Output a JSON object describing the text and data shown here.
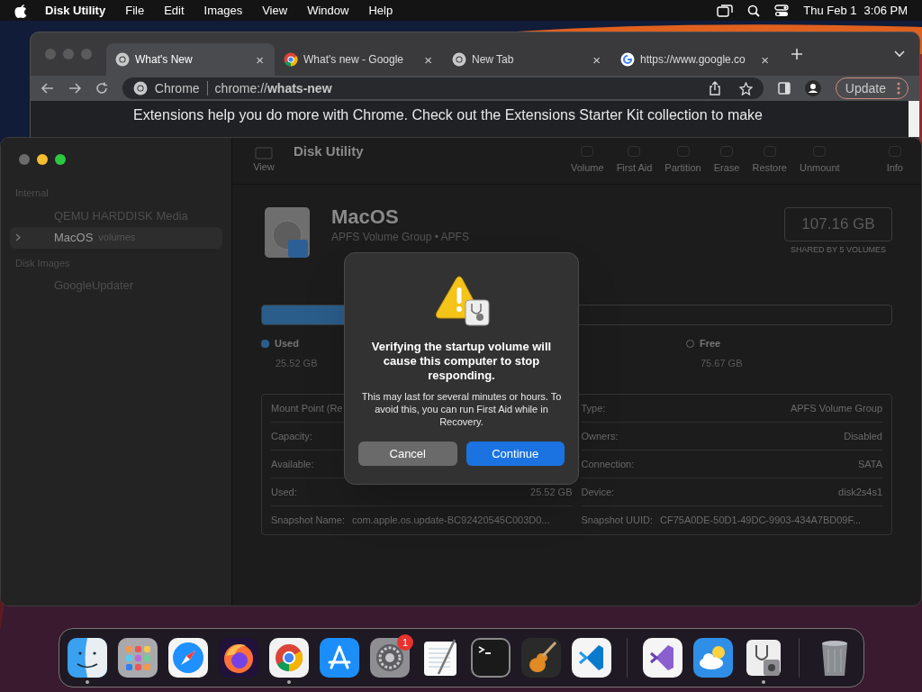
{
  "menu_bar": {
    "app": "Disk Utility",
    "menus": [
      "File",
      "Edit",
      "Images",
      "View",
      "Window",
      "Help"
    ],
    "date": "Thu Feb 1",
    "time": "3:06 PM"
  },
  "browser": {
    "tabs": [
      {
        "title": "What's New",
        "kind": "chrome-mono",
        "close": "×",
        "selected": true
      },
      {
        "title": "What's new - Google",
        "kind": "chrome",
        "close": "×",
        "selected": false
      },
      {
        "title": "New Tab",
        "kind": "chrome-mono",
        "close": "×",
        "selected": false
      },
      {
        "title": "https://www.google.co",
        "kind": "google",
        "close": "×",
        "selected": false
      }
    ],
    "omnibox": {
      "site": "Chrome",
      "url": "chrome://**whats-new**"
    },
    "update_button": "Update",
    "content_text": "Extensions help you do more with Chrome. Check out the Extensions Starter Kit collection to make"
  },
  "disk_utility": {
    "title": "Disk Utility",
    "view_label": "View",
    "toolbar": [
      "Volume",
      "First Aid",
      "Partition",
      "Erase",
      "Restore",
      "Unmount",
      "Info"
    ],
    "sidebar": [
      {
        "heading": "Internal",
        "items": [
          {
            "name": "QEMU HARDDISK Media",
            "selected": false
          },
          {
            "name": "MacOS",
            "sub": "volumes",
            "selected": true,
            "expanded": false
          }
        ]
      },
      {
        "heading": "Disk Images",
        "items": [
          {
            "name": "GoogleUpdater",
            "selected": false
          }
        ]
      }
    ],
    "volume": {
      "name": "MacOS",
      "type": "APFS Volume Group • APFS",
      "capacity": "107.16 GB",
      "shared": "SHARED BY 5 VOLUMES"
    },
    "usage": {
      "level": 0.25,
      "used": {
        "label": "Used",
        "value": "25.52 GB",
        "color": "#2a5d8a"
      },
      "free": {
        "label": "Free",
        "value": "75.67 GB"
      }
    },
    "info_left": [
      {
        "label": "Mount Point (Re"
      },
      {
        "label": "Capacity:"
      },
      {
        "label": "Available:"
      },
      {
        "label": "Used:",
        "value": "25.52 GB"
      },
      {
        "label": "Snapshot Name:",
        "value": "com.apple.os.update-BC92420545C003D0..."
      }
    ],
    "info_right": [
      {
        "label": "Type:",
        "value": "APFS Volume Group"
      },
      {
        "label": "Owners:",
        "value": "Disabled"
      },
      {
        "label": "Connection:",
        "value": "SATA"
      },
      {
        "label": "Device:",
        "value": "disk2s4s1"
      },
      {
        "label": "Snapshot UUID:",
        "value": "CF75A0DE-50D1-49DC-9903-434A7BD09F..."
      }
    ]
  },
  "dialog": {
    "title": "Verifying the startup volume will cause this computer to stop responding.",
    "message": "This may last for several minutes or hours. To avoid this, you can run First Aid while in Recovery.",
    "buttons": [
      {
        "label": "Cancel",
        "default": false
      },
      {
        "label": "Continue",
        "default": true
      }
    ]
  },
  "dock": {
    "groups": [
      [
        {
          "kind": "finder",
          "running": true
        },
        {
          "kind": "launchpad",
          "running": false
        },
        {
          "kind": "safari",
          "running": false
        },
        {
          "kind": "firefox",
          "running": false
        },
        {
          "kind": "chrome",
          "running": true
        },
        {
          "kind": "appstore",
          "running": false
        },
        {
          "kind": "settings",
          "running": false,
          "badge": "1"
        },
        {
          "kind": "textedit",
          "running": false
        },
        {
          "kind": "terminal",
          "running": false
        },
        {
          "kind": "garageband",
          "running": false
        },
        {
          "kind": "vscode",
          "running": false
        }
      ],
      [
        {
          "kind": "visualstudio",
          "running": false
        },
        {
          "kind": "weather",
          "running": false
        },
        {
          "kind": "diskutility",
          "running": true
        }
      ],
      [
        {
          "kind": "trash",
          "running": false
        }
      ]
    ]
  }
}
